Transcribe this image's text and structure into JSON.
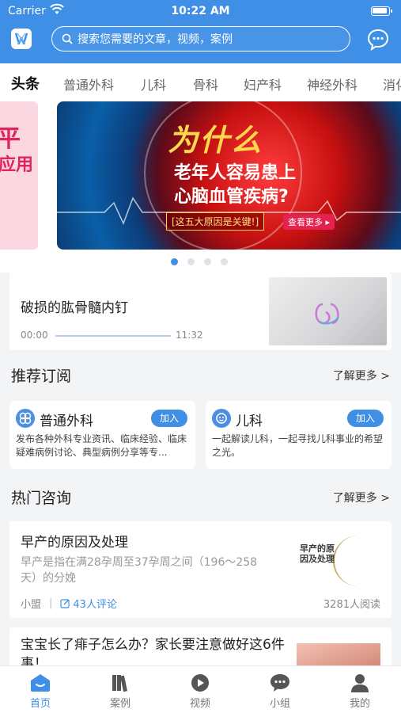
{
  "status_bar": {
    "carrier": "Carrier",
    "time": "10:22 AM"
  },
  "search": {
    "placeholder": "搜索您需要的文章，视频，案例"
  },
  "tabs": [
    "头条",
    "普通外科",
    "儿科",
    "骨科",
    "妇产科",
    "神经外科",
    "消化"
  ],
  "active_tab": "头条",
  "banner": {
    "title": "为什么",
    "line1": "老年人容易患上",
    "line2": "心脑血管疾病?",
    "tag": "[这五大原因是关键!]",
    "more": "查看更多 ▸",
    "side_text_1": "平",
    "side_text_2": "应用",
    "page_count": 4,
    "active_index": 0
  },
  "video": {
    "title": "破损的肱骨髓内钉",
    "current_time": "00:00",
    "duration": "11:32"
  },
  "recommend": {
    "title": "推荐订阅",
    "more": "了解更多 >",
    "cards": [
      {
        "name": "普通外科",
        "join": "加入",
        "desc": "发布各种外科专业资讯、临床经验、临床疑难病例讨论、典型病例分享等专..."
      },
      {
        "name": "儿科",
        "join": "加入",
        "desc": "一起解读儿科，一起寻找儿科事业的希望之光。"
      }
    ]
  },
  "hot": {
    "title": "热门咨询",
    "more": "了解更多 >",
    "articles": [
      {
        "title": "早产的原因及处理",
        "body": "早产是指在满28孕周至37孕周之间（196～258天）的分娩",
        "author": "小盟",
        "comments": "43人评论",
        "reads": "3281人阅读",
        "thumb_text": "早产的原因及处理"
      },
      {
        "title": "宝宝长了痱子怎么办？家长要注意做好这6件事！"
      }
    ]
  },
  "bottom_nav": [
    {
      "label": "首页",
      "icon": "home-icon",
      "active": true
    },
    {
      "label": "案例",
      "icon": "books-icon",
      "active": false
    },
    {
      "label": "视频",
      "icon": "play-icon",
      "active": false
    },
    {
      "label": "小组",
      "icon": "chat-bubble-icon",
      "active": false
    },
    {
      "label": "我的",
      "icon": "user-icon",
      "active": false
    }
  ],
  "colors": {
    "brand": "#3f8fe6",
    "background": "#f3f4f6"
  }
}
